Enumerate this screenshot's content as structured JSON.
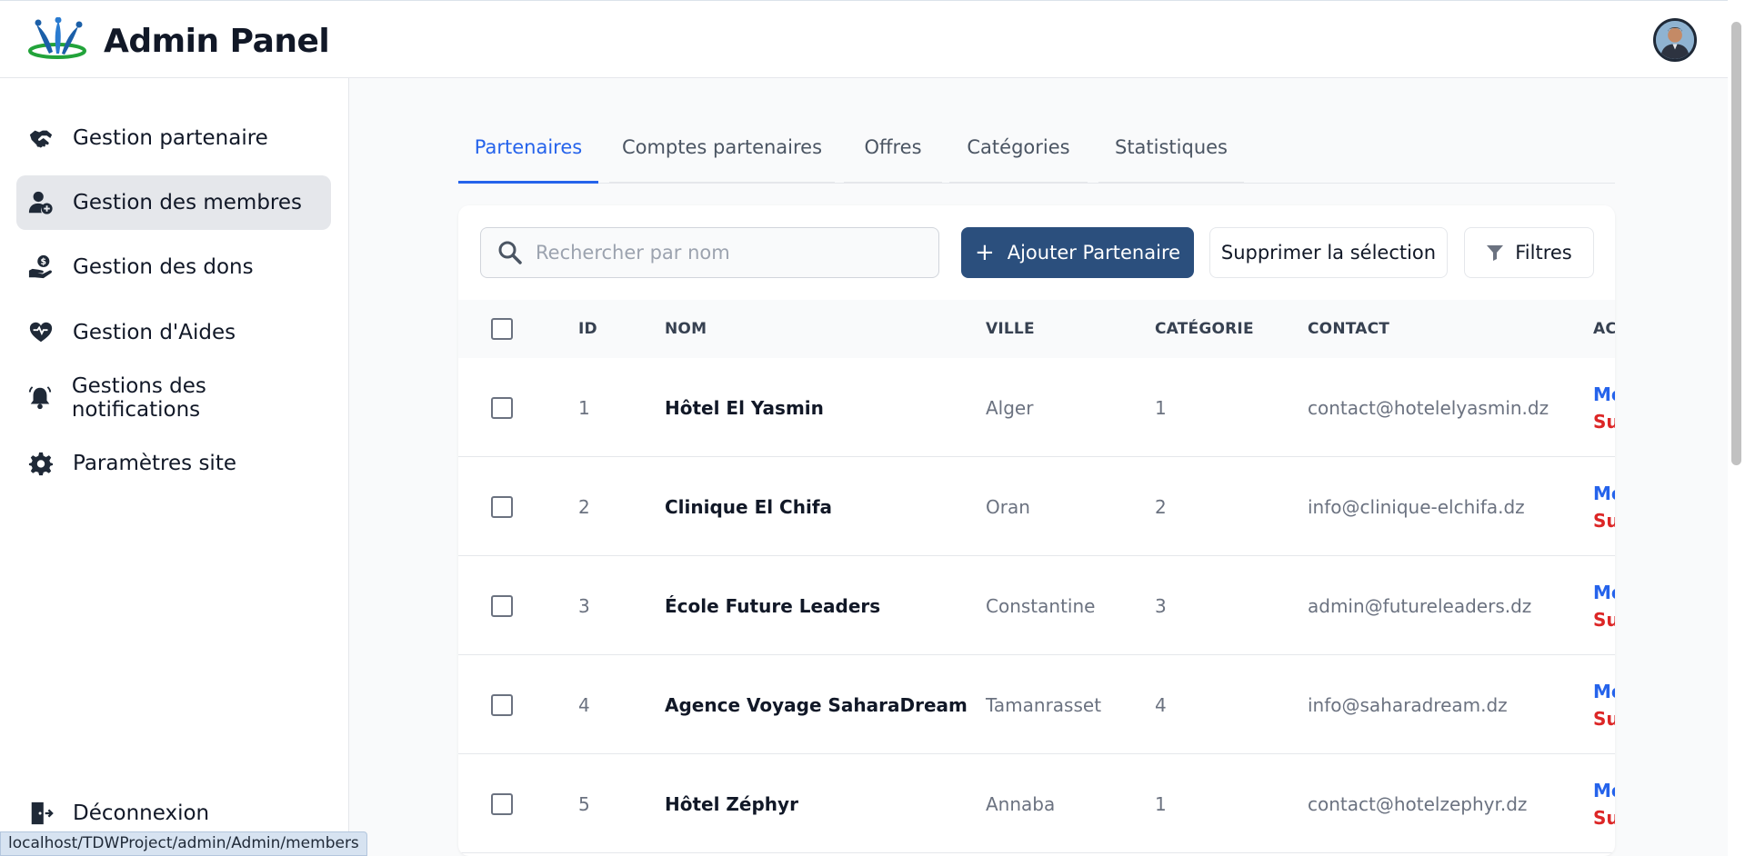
{
  "header": {
    "title": "Admin Panel",
    "logo": "logo",
    "avatar": "user-avatar"
  },
  "sidebar": {
    "items": [
      {
        "label": "Gestion partenaire",
        "icon": "handshake-icon"
      },
      {
        "label": "Gestion des membres",
        "icon": "user-plus-icon",
        "active": true
      },
      {
        "label": "Gestion des dons",
        "icon": "donation-hand-icon"
      },
      {
        "label": "Gestion d'Aides",
        "icon": "heart-hands-icon"
      },
      {
        "label": "Gestions des notifications",
        "icon": "bell-icon"
      },
      {
        "label": "Paramètres site",
        "icon": "gear-icon"
      }
    ],
    "logout": {
      "label": "Déconnexion",
      "icon": "door-exit-icon"
    }
  },
  "tabs": [
    {
      "label": "Partenaires",
      "active": true
    },
    {
      "label": "Comptes partenaires"
    },
    {
      "label": "Offres"
    },
    {
      "label": "Catégories"
    },
    {
      "label": "Statistiques"
    }
  ],
  "toolbar": {
    "search_placeholder": "Rechercher par nom",
    "search_value": "",
    "add_label": "Ajouter Partenaire",
    "delete_label": "Supprimer la sélection",
    "filter_label": "Filtres"
  },
  "table": {
    "headers": {
      "id": "ID",
      "nom": "NOM",
      "ville": "VILLE",
      "categorie": "CATÉGORIE",
      "contact": "CONTACT",
      "actions": "AC"
    },
    "rows": [
      {
        "id": "1",
        "nom": "Hôtel El Yasmin",
        "ville": "Alger",
        "categorie": "1",
        "contact": "contact@hotelelyasmin.dz",
        "act_edit": "Mo",
        "act_delete": "Su"
      },
      {
        "id": "2",
        "nom": "Clinique El Chifa",
        "ville": "Oran",
        "categorie": "2",
        "contact": "info@clinique-elchifa.dz",
        "act_edit": "Mo",
        "act_delete": "Su"
      },
      {
        "id": "3",
        "nom": "École Future Leaders",
        "ville": "Constantine",
        "categorie": "3",
        "contact": "admin@futureleaders.dz",
        "act_edit": "Mo",
        "act_delete": "Su"
      },
      {
        "id": "4",
        "nom": "Agence Voyage SaharaDream",
        "ville": "Tamanrasset",
        "categorie": "4",
        "contact": "info@saharadream.dz",
        "act_edit": "Mo",
        "act_delete": "Su"
      },
      {
        "id": "5",
        "nom": "Hôtel Zéphyr",
        "ville": "Annaba",
        "categorie": "1",
        "contact": "contact@hotelzephyr.dz",
        "act_edit": "Mo",
        "act_delete": "Su"
      }
    ]
  },
  "statusbar": {
    "url": "localhost/TDWProject/admin/Admin/members"
  },
  "colors": {
    "accent": "#2563eb",
    "primary_button": "#2b4f7d",
    "danger": "#dc2626"
  }
}
